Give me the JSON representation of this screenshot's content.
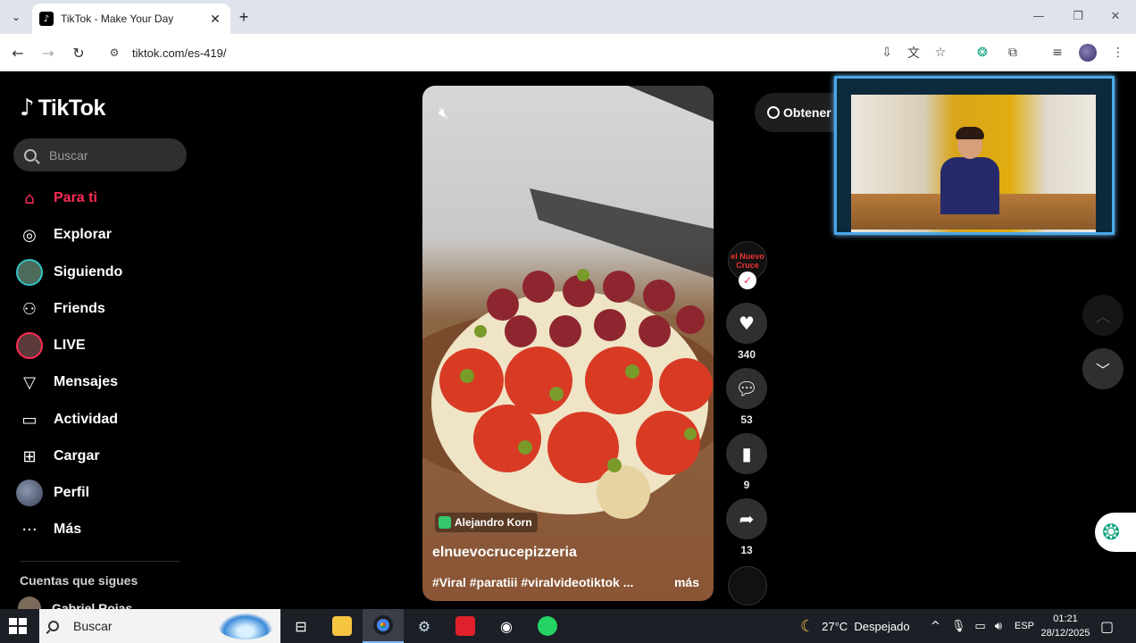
{
  "browser": {
    "tab_title": "TikTok - Make Your Day",
    "url": "tiktok.com/es-419/"
  },
  "sidebar": {
    "logo": "TikTok",
    "search_placeholder": "Buscar",
    "items": [
      {
        "label": "Para ti",
        "icon": "home-icon"
      },
      {
        "label": "Explorar",
        "icon": "compass-icon"
      },
      {
        "label": "Siguiendo",
        "icon": "avatar"
      },
      {
        "label": "Friends",
        "icon": "friends-icon"
      },
      {
        "label": "LIVE",
        "icon": "live-avatar"
      },
      {
        "label": "Mensajes",
        "icon": "send-icon"
      },
      {
        "label": "Actividad",
        "icon": "activity-icon"
      },
      {
        "label": "Cargar",
        "icon": "upload-icon"
      },
      {
        "label": "Perfil",
        "icon": "profile-avatar"
      },
      {
        "label": "Más",
        "icon": "more-icon"
      }
    ],
    "following_heading": "Cuentas que sigues",
    "following": [
      {
        "name": "Gabriel Rojas"
      }
    ]
  },
  "video": {
    "creator_badge": "Alejandro Korn",
    "username": "elnuevocrucepizzeria",
    "caption": "#Viral #paratiii #viralvideotiktok ...",
    "more": "más"
  },
  "actions": {
    "likes": "340",
    "comments": "53",
    "saves": "9",
    "shares": "13",
    "avatar_text": "el Nuevo Cruce"
  },
  "get_app": "Obtener",
  "taskbar": {
    "search": "Buscar",
    "weather": "27°C  Despejado",
    "lang": "ESP",
    "time": "01:21",
    "date": "28/12/2025"
  },
  "colors": {
    "accent": "#fe2c55",
    "webcam_border": "#4aa8e8"
  }
}
